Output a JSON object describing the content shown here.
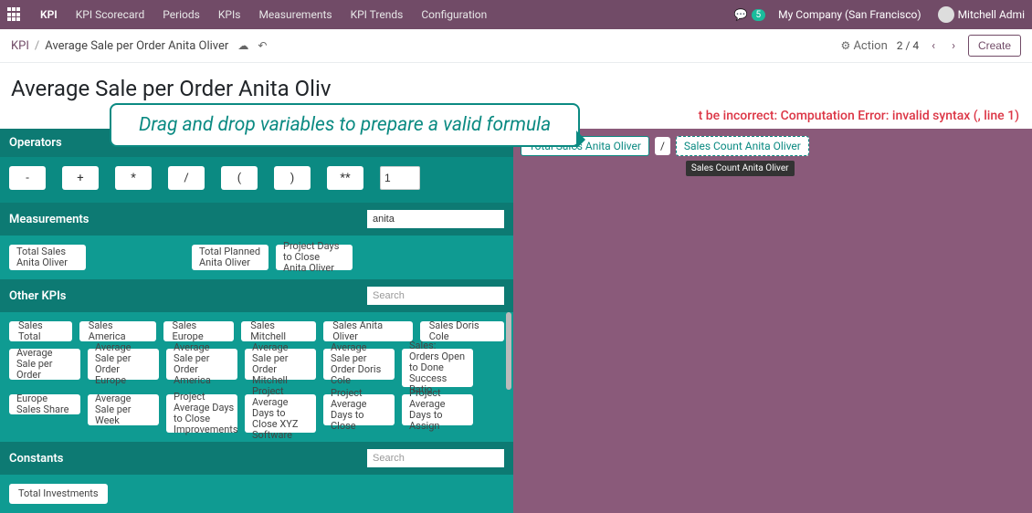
{
  "topnav": {
    "app": "KPI",
    "items": [
      "KPI Scorecard",
      "Periods",
      "KPIs",
      "Measurements",
      "KPI Trends",
      "Configuration"
    ],
    "chat_count": "5",
    "company": "My Company (San Francisco)",
    "user": "Mitchell Admi"
  },
  "breadcrumb": {
    "root": "KPI",
    "leaf": "Average Sale per Order Anita Oliver"
  },
  "controlbar": {
    "action_label": "Action",
    "pager": "2 / 4",
    "create_label": "Create"
  },
  "page_title": "Average Sale per Order Anita Oliv",
  "error_msg": "t be incorrect: Computation Error: invalid syntax (, line 1)",
  "callout": "Drag and drop variables to prepare a valid formula",
  "sections": {
    "operators_label": "Operators",
    "measurements_label": "Measurements",
    "measurements_search": "anita",
    "otherkpis_label": "Other KPIs",
    "otherkpis_placeholder": "Search",
    "constants_label": "Constants",
    "constants_placeholder": "Search"
  },
  "operators": {
    "list": [
      "-",
      "+",
      "*",
      "/",
      "(",
      ")",
      "**"
    ],
    "number_value": "1"
  },
  "measurements": [
    "Total Sales Anita Oliver",
    "Total Planned Anita Oliver",
    "Project Days to Close Anita Oliver"
  ],
  "kpi_row1": [
    "Sales Total",
    "Sales America",
    "Sales Europe",
    "Sales Mitchell",
    "Sales Anita Oliver",
    "Sales Doris Cole"
  ],
  "kpi_row2": [
    "Average Sale per Order",
    "Average Sale per Order Europe",
    "Average Sale per Order America",
    "Average Sale per Order Mitchell",
    "Average Sale per Order Doris Cole",
    "Sales: Orders Open to Done Success Ratio"
  ],
  "kpi_row3": [
    "Europe Sales Share",
    "Average Sale per Week",
    "Project Average Days to Close Improvements",
    "Project Average Days to Close XYZ Software",
    "Project Average Days to Close",
    "Project Average Days to Assign"
  ],
  "constants": [
    "Total Investments"
  ],
  "formula": {
    "chip1": "Total Sales Anita Oliver",
    "op": "/",
    "chip2": "Sales Count Anita Oliver",
    "tooltip": "Sales Count Anita Oliver"
  }
}
